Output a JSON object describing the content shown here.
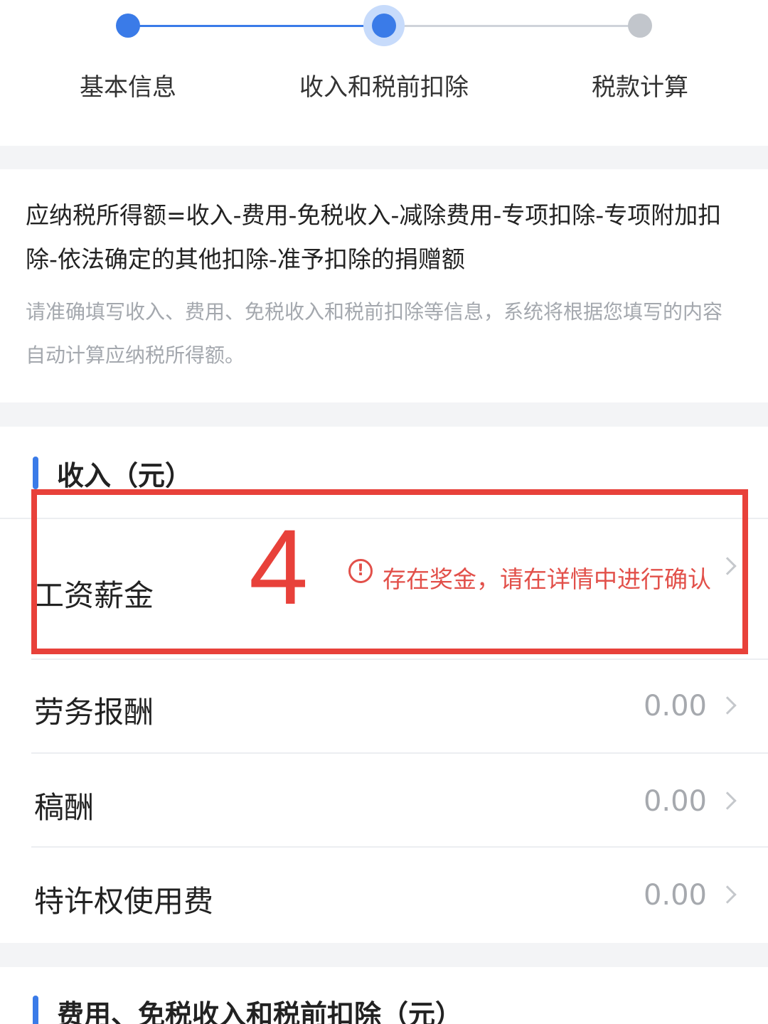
{
  "stepper": {
    "steps": [
      {
        "label": "基本信息",
        "state": "done"
      },
      {
        "label": "收入和税前扣除",
        "state": "current"
      },
      {
        "label": "税款计算",
        "state": "todo"
      }
    ]
  },
  "formula": {
    "text": "应纳税所得额=收入-费用-免税收入-减除费用-专项扣除-专项附加扣除-依法确定的其他扣除-准予扣除的捐赠额",
    "hint": "请准确填写收入、费用、免税收入和税前扣除等信息，系统将根据您填写的内容自动计算应纳税所得额。"
  },
  "income": {
    "title": "收入（元）",
    "rows": [
      {
        "label": "工资薪金",
        "warning": "存在奖金，请在详情中进行确认"
      },
      {
        "label": "劳务报酬",
        "value": "0.00"
      },
      {
        "label": "稿酬",
        "value": "0.00"
      },
      {
        "label": "特许权使用费",
        "value": "0.00"
      }
    ]
  },
  "annotation": {
    "number": "4",
    "color": "#e8413a"
  },
  "expenses": {
    "title": "费用、免税收入和税前扣除（元）"
  },
  "colors": {
    "accent": "#3a7be8",
    "warning": "#e2504a"
  }
}
